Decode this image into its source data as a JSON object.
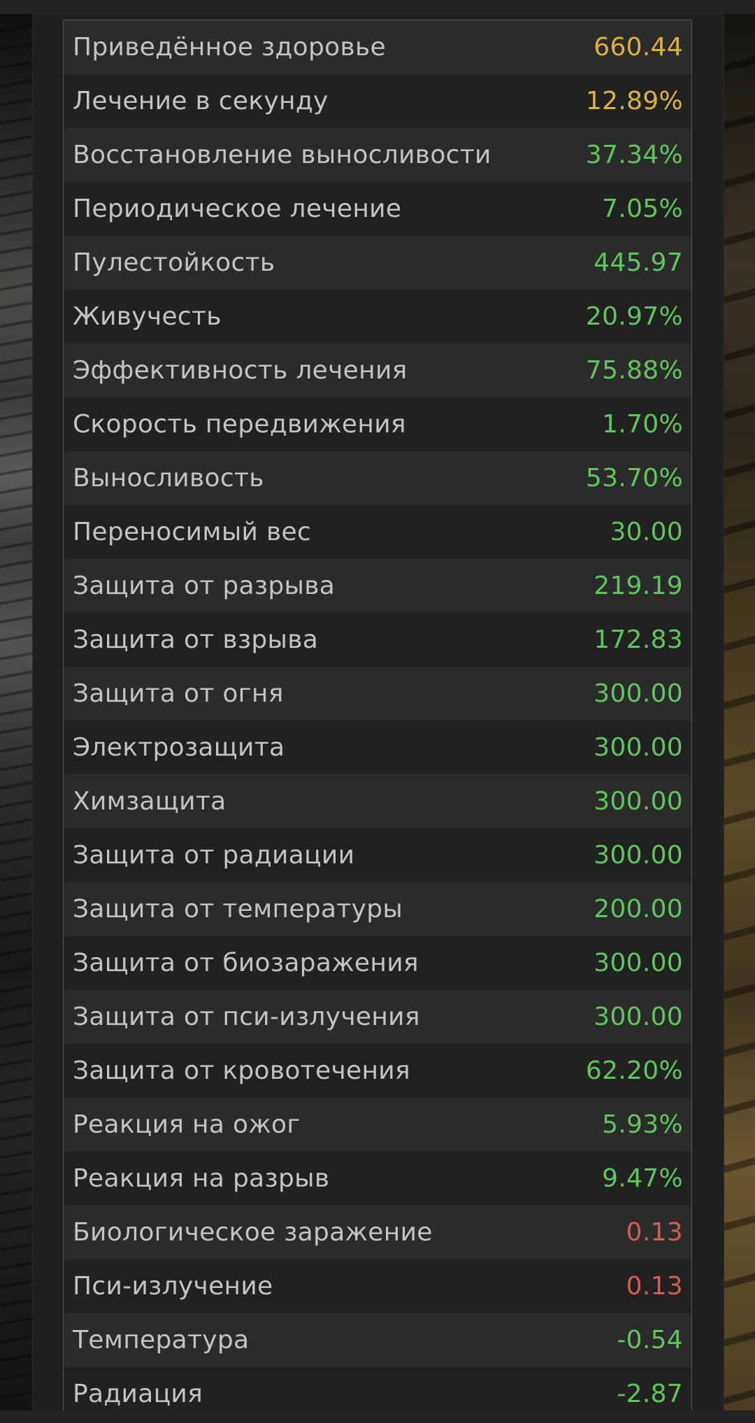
{
  "colors": {
    "yellow": "#e0b03c",
    "green": "#5cc85a",
    "red": "#d85a55"
  },
  "stats": [
    {
      "label": "Приведённое здоровье",
      "value": "660.44",
      "tone": "yellow"
    },
    {
      "label": "Лечение в секунду",
      "value": "12.89%",
      "tone": "yellow"
    },
    {
      "label": "Восстановление выносливости",
      "value": "37.34%",
      "tone": "green"
    },
    {
      "label": "Периодическое лечение",
      "value": "7.05%",
      "tone": "green"
    },
    {
      "label": "Пулестойкость",
      "value": "445.97",
      "tone": "green"
    },
    {
      "label": "Живучесть",
      "value": "20.97%",
      "tone": "green"
    },
    {
      "label": "Эффективность лечения",
      "value": "75.88%",
      "tone": "green"
    },
    {
      "label": "Скорость передвижения",
      "value": "1.70%",
      "tone": "green"
    },
    {
      "label": "Выносливость",
      "value": "53.70%",
      "tone": "green"
    },
    {
      "label": "Переносимый вес",
      "value": "30.00",
      "tone": "green"
    },
    {
      "label": "Защита от разрыва",
      "value": "219.19",
      "tone": "green"
    },
    {
      "label": "Защита от взрыва",
      "value": "172.83",
      "tone": "green"
    },
    {
      "label": "Защита от огня",
      "value": "300.00",
      "tone": "green"
    },
    {
      "label": "Электрозащита",
      "value": "300.00",
      "tone": "green"
    },
    {
      "label": "Химзащита",
      "value": "300.00",
      "tone": "green"
    },
    {
      "label": "Защита от радиации",
      "value": "300.00",
      "tone": "green"
    },
    {
      "label": "Защита от температуры",
      "value": "200.00",
      "tone": "green"
    },
    {
      "label": "Защита от биозаражения",
      "value": "300.00",
      "tone": "green"
    },
    {
      "label": "Защита от пси-излучения",
      "value": "300.00",
      "tone": "green"
    },
    {
      "label": "Защита от кровотечения",
      "value": "62.20%",
      "tone": "green"
    },
    {
      "label": "Реакция на ожог",
      "value": "5.93%",
      "tone": "green"
    },
    {
      "label": "Реакция на разрыв",
      "value": "9.47%",
      "tone": "green"
    },
    {
      "label": "Биологическое заражение",
      "value": "0.13",
      "tone": "red"
    },
    {
      "label": "Пси-излучение",
      "value": "0.13",
      "tone": "red"
    },
    {
      "label": "Температура",
      "value": "-0.54",
      "tone": "green"
    },
    {
      "label": "Радиация",
      "value": "-2.87",
      "tone": "green"
    }
  ]
}
